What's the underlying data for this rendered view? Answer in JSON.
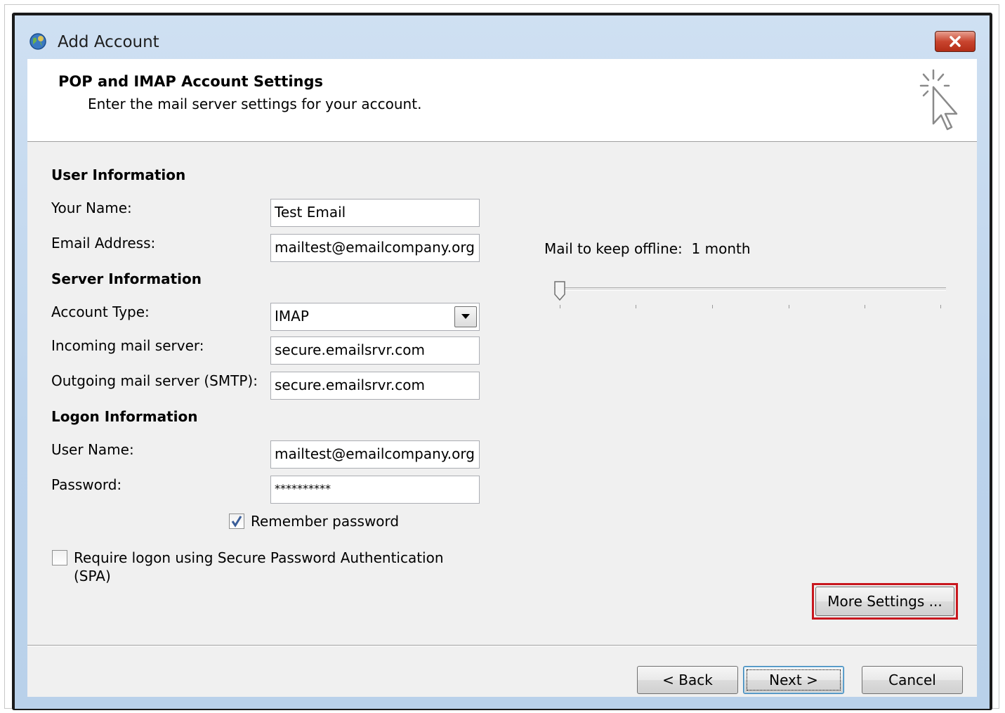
{
  "window": {
    "title": "Add Account"
  },
  "header": {
    "title": "POP and IMAP Account Settings",
    "subtitle": "Enter the mail server settings for your account."
  },
  "user_info": {
    "section_label": "User Information",
    "name_label": "Your Name:",
    "name_value": "Test Email",
    "email_label": "Email Address:",
    "email_value": "mailtest@emailcompany.org"
  },
  "server_info": {
    "section_label": "Server Information",
    "account_type_label": "Account Type:",
    "account_type_value": "IMAP",
    "incoming_label": "Incoming mail server:",
    "incoming_value": "secure.emailsrvr.com",
    "outgoing_label": "Outgoing mail server (SMTP):",
    "outgoing_value": "secure.emailsrvr.com"
  },
  "logon_info": {
    "section_label": "Logon Information",
    "username_label": "User Name:",
    "username_value": "mailtest@emailcompany.org",
    "password_label": "Password:",
    "password_value": "**********",
    "remember_label": "Remember password",
    "remember_checked": true,
    "spa_label_line1": "Require logon using Secure Password Authentication",
    "spa_label_line2": "(SPA)",
    "spa_checked": false
  },
  "offline": {
    "label": "Mail to keep offline:",
    "value": "1 month",
    "slider_position": 0
  },
  "buttons": {
    "more_settings": "More Settings ...",
    "back": "< Back",
    "next": "Next >",
    "cancel": "Cancel"
  },
  "colors": {
    "highlight": "#c8171e",
    "title_bar": "#bcd3ec",
    "close_button": "#c9452f"
  }
}
